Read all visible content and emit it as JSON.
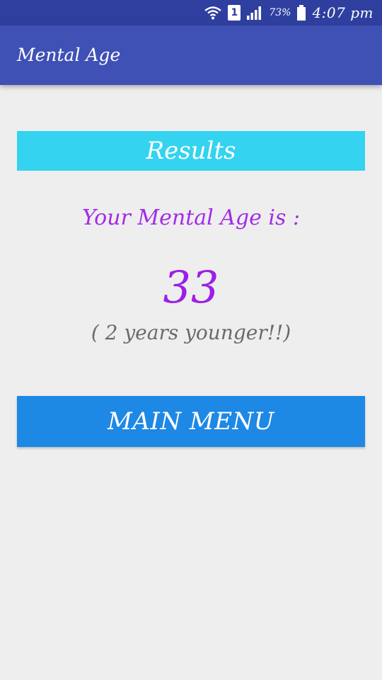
{
  "status_bar": {
    "sim_slot": "1",
    "battery": "73%",
    "time": "4:07 pm",
    "icons": [
      "wifi-icon",
      "sim-icon",
      "signal-icon",
      "battery-icon"
    ]
  },
  "app_bar": {
    "title": "Mental Age"
  },
  "results": {
    "header": "Results",
    "label": "Your Mental Age is :",
    "age": "33",
    "difference": "( 2 years younger!!)"
  },
  "buttons": {
    "main_menu": "MAIN MENU"
  },
  "colors": {
    "status_bar": "#2f3f9f",
    "app_bar": "#3f51b5",
    "results_header": "#34d3ef",
    "age_text": "#a22ce6",
    "difference_text": "#6a6a6a",
    "main_menu_button": "#1e88e5",
    "background": "#eeeeee"
  }
}
